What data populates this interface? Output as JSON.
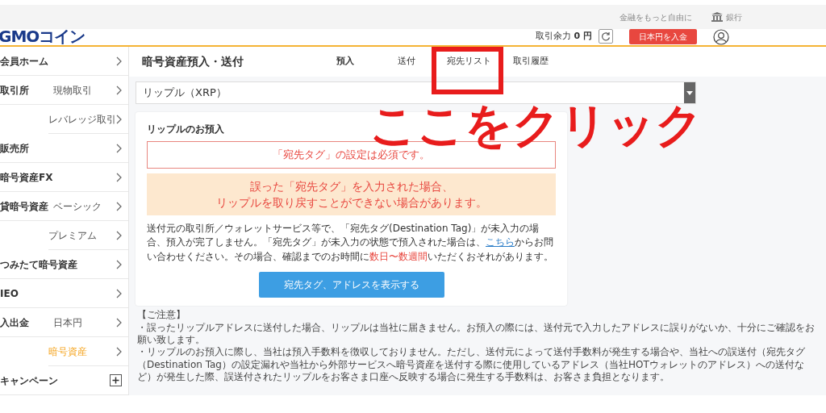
{
  "top_bar": {
    "tagline": "金融をもっと自由に",
    "bank_link": "銀行"
  },
  "header": {
    "logo": "GMOコイン",
    "balance_label": "取引余力",
    "balance_value": "0 円",
    "deposit_button": "日本円を入金"
  },
  "sidebar": {
    "groups": [
      {
        "label": "会員ホーム",
        "kind": "link"
      },
      {
        "label": "取引所",
        "kind": "link",
        "items": [
          {
            "label": "現物取引",
            "selected": false
          },
          {
            "label": "レバレッジ取引",
            "selected": false
          }
        ]
      },
      {
        "label": "販売所",
        "kind": "link"
      },
      {
        "label": "暗号資産FX",
        "kind": "link"
      },
      {
        "label": "貸暗号資産",
        "kind": "link",
        "items": [
          {
            "label": "ベーシック",
            "selected": false
          },
          {
            "label": "プレミアム",
            "selected": false
          }
        ]
      },
      {
        "label": "つみたて暗号資産",
        "kind": "link"
      },
      {
        "label": "IEO",
        "kind": "link"
      },
      {
        "label": "入出金",
        "kind": "link",
        "items": [
          {
            "label": "日本円",
            "selected": false
          },
          {
            "label": "暗号資産",
            "selected": true
          }
        ]
      },
      {
        "label": "キャンペーン",
        "kind": "expand"
      }
    ]
  },
  "page": {
    "title": "暗号資産預入・送付",
    "tabs": [
      {
        "label": "預入",
        "selected": true
      },
      {
        "label": "送付",
        "selected": false
      },
      {
        "label": "宛先リスト",
        "selected": false
      },
      {
        "label": "取引履歴",
        "selected": false
      }
    ],
    "currency_select": "リップル（XRP）"
  },
  "card": {
    "title": "リップルのお預入",
    "required_notice": "「宛先タグ」の設定は必須です。",
    "warning_lines": [
      "誤った「宛先タグ」を入力された場合、",
      "リップルを取り戻すことができない場合があります。"
    ],
    "body": [
      "送付元の取引所／ウォレットサービス等で、「宛先タグ(Destination Tag)」が未入力の場合、預入が完了しません。「宛先タグ」が未入力の状態で預入された場合は、",
      "こちら",
      "からお問い合わせください。その場合、確認までのお時間に",
      "数日〜数週間",
      "いただくおそれがあります。"
    ],
    "button": "宛先タグ、アドレスを表示する"
  },
  "notes": {
    "heading": "【ご注意】",
    "items": [
      "・誤ったリップルアドレスに送付した場合、リップルは当社に届きません。お預入の際には、送付元で入力したアドレスに誤りがないか、十分にご確認をお願い致します。",
      "・リップルのお預入に際し、当社は預入手数料を徴収しておりません。ただし、送付元によって送付手数料が発生する場合や、当社への誤送付（宛先タグ（Destination Tag）の設定漏れや当社から外部サービスへ暗号資産を送付する際に使用しているアドレス（当社HOTウォレットのアドレス）への送付など）が発生した際、誤送付されたリップルをお客さま口座へ反映する場合に発生する手数料は、お客さま負担となります。"
    ]
  },
  "annotation": {
    "text": "ここをクリック"
  }
}
